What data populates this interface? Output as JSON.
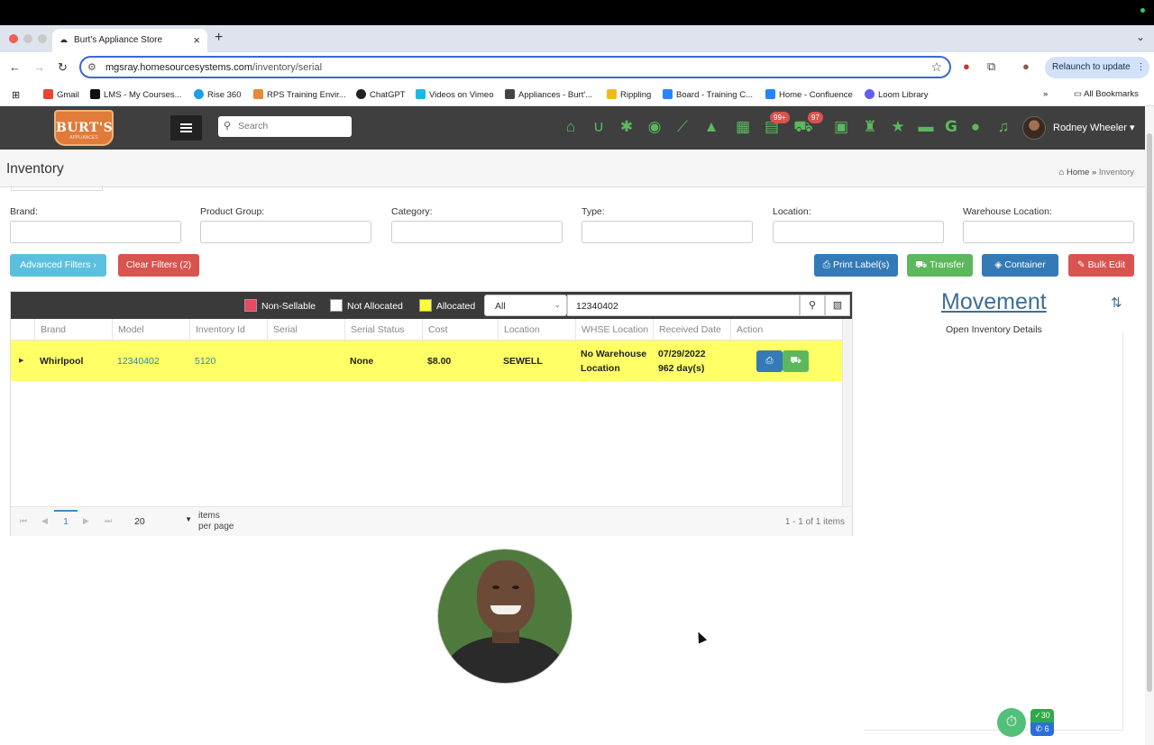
{
  "browser": {
    "tab_title": "Burt's Appliance Store",
    "url_host": "mgsray.homesourcesystems.com",
    "url_path": "/inventory/serial",
    "relaunch_label": "Relaunch to update",
    "bookmarks": [
      {
        "label": "Gmail",
        "color": "#ea4335"
      },
      {
        "label": "LMS - My Courses...",
        "color": "#111111"
      },
      {
        "label": "Rise 360",
        "color": "#1aa0e8"
      },
      {
        "label": "RPS Training Envir...",
        "color": "#e58a3a"
      },
      {
        "label": "ChatGPT",
        "color": "#222222"
      },
      {
        "label": "Videos on Vimeo",
        "color": "#1ab7ea"
      },
      {
        "label": "Appliances - Burt'...",
        "color": "#444444"
      },
      {
        "label": "Rippling",
        "color": "#f2b91c"
      },
      {
        "label": "Board - Training C...",
        "color": "#2684ff"
      },
      {
        "label": "Home - Confluence",
        "color": "#2684ff"
      },
      {
        "label": "Loom Library",
        "color": "#625df5"
      }
    ],
    "all_bookmarks_label": "All Bookmarks"
  },
  "header": {
    "logo_text": "BURT'S",
    "logo_sub": "APPLIANCES",
    "search_placeholder": "Search",
    "cart_badge_1": "99+",
    "cart_badge_2": "97",
    "user_name": "Rodney Wheeler"
  },
  "page": {
    "title": "Inventory",
    "breadcrumb_home": "Home",
    "breadcrumb_current": "Inventory"
  },
  "filters": {
    "labels": [
      "Brand:",
      "Product Group:",
      "Category:",
      "Type:",
      "Location:",
      "Warehouse Location:"
    ],
    "advanced_label": "Advanced Filters",
    "clear_label": "Clear Filters (2)",
    "print_label": "Print Label(s)",
    "transfer_label": "Transfer",
    "container_label": "Container",
    "bulk_edit_label": "Bulk Edit"
  },
  "grid": {
    "legend": {
      "non_sellable": "Non-Sellable",
      "not_allocated": "Not Allocated",
      "allocated": "Allocated"
    },
    "legend_colors": {
      "non_sellable": "#e84a5f",
      "not_allocated": "#ffffff",
      "allocated": "#ffff33"
    },
    "select_value": "All",
    "search_value": "12340402",
    "columns": [
      "Brand",
      "Model",
      "Inventory Id",
      "Serial",
      "Serial Status",
      "Cost",
      "Location",
      "WHSE Location",
      "Received Date",
      "Action"
    ],
    "row": {
      "brand": "Whirlpool",
      "model": "12340402",
      "inventory_id": "5120",
      "serial": "",
      "serial_status": "None",
      "cost": "$8.00",
      "location": "SEWELL",
      "whse_location_1": "No Warehouse",
      "whse_location_2": "Location",
      "received_date": "07/29/2022",
      "received_days": "962 day(s)"
    },
    "pager": {
      "page": "1",
      "page_size": "20",
      "items_label_1": "items",
      "items_label_2": "per page",
      "info": "1 - 1 of 1 items"
    }
  },
  "right_panel": {
    "title": "Movement",
    "subtitle": "Open Inventory Details"
  },
  "widgets": {
    "done_count": "30",
    "call_count": "6"
  }
}
